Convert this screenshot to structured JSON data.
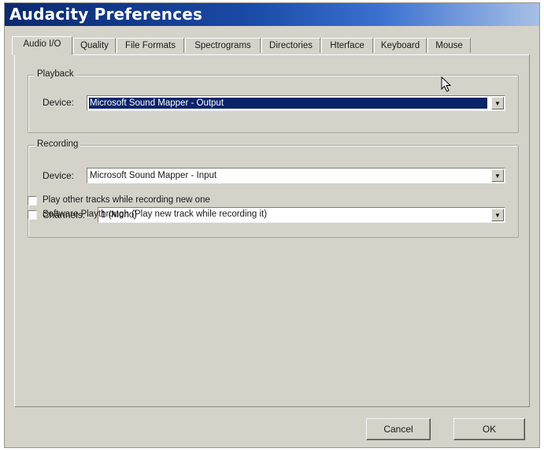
{
  "window": {
    "title": "Audacity Preferences"
  },
  "tabs": [
    {
      "label": "Audio I/O",
      "active": true
    },
    {
      "label": "Quality",
      "active": false
    },
    {
      "label": "File Formats",
      "active": false
    },
    {
      "label": "Spectrograms",
      "active": false
    },
    {
      "label": "Directories",
      "active": false
    },
    {
      "label": "Hterface",
      "active": false
    },
    {
      "label": "Keyboard",
      "active": false
    },
    {
      "label": "Mouse",
      "active": false
    }
  ],
  "playback": {
    "group_label": "Playback",
    "device_label": "Device:",
    "device_value": "Microsoft Sound Mapper - Output"
  },
  "recording": {
    "group_label": "Recording",
    "device_label": "Device:",
    "device_value": "Microsoft Sound Mapper - Input",
    "channels_label": "Channels:",
    "channels_value": "1 (Mono)"
  },
  "options": [
    {
      "label": "Play other tracks while recording new one",
      "checked": false
    },
    {
      "label": "Software Playthrough (Play new track while recording it)",
      "checked": false
    }
  ],
  "buttons": {
    "cancel": "Cancel",
    "ok": "OK"
  },
  "colors": {
    "selection": "#0a246a",
    "dialog_face": "#d5d2ca",
    "title_start": "#0a2a6e",
    "title_end": "#a7c0e6"
  }
}
